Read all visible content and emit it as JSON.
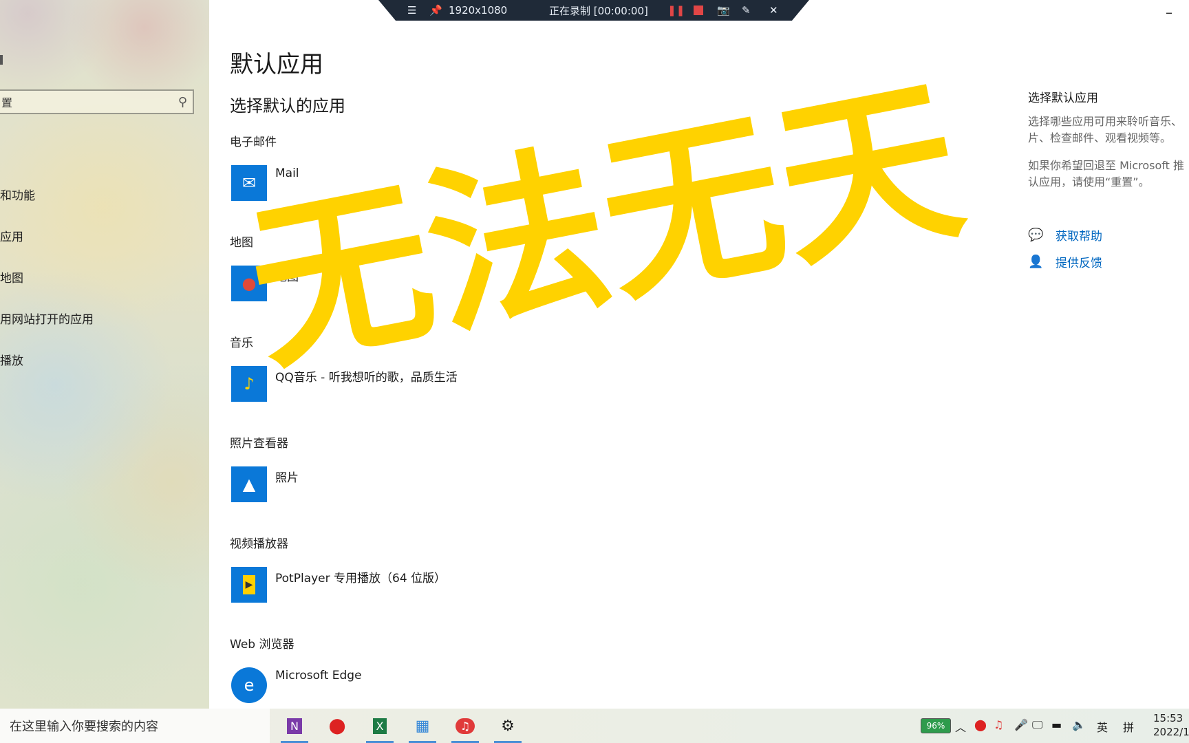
{
  "recording_bar": {
    "resolution": "1920x1080",
    "status": "正在录制 [00:00:00]"
  },
  "sidebar": {
    "search_value": "置",
    "items": [
      {
        "label": "和功能"
      },
      {
        "label": "应用"
      },
      {
        "label": "地图"
      },
      {
        "label": "用网站打开的应用"
      },
      {
        "label": "播放"
      }
    ]
  },
  "main": {
    "page_title": "默认应用",
    "section_title": "选择默认的应用",
    "categories": [
      {
        "label": "电子邮件",
        "app": "Mail"
      },
      {
        "label": "地图",
        "app": "地图"
      },
      {
        "label": "音乐",
        "app": "QQ音乐 - 听我想听的歌，品质生活"
      },
      {
        "label": "照片查看器",
        "app": "照片"
      },
      {
        "label": "视频播放器",
        "app": "PotPlayer 专用播放（64 位版）"
      },
      {
        "label": "Web 浏览器",
        "app": "Microsoft Edge"
      }
    ]
  },
  "info_panel": {
    "title": "选择默认应用",
    "para1_line1": "选择哪些应用可用来聆听音乐、",
    "para1_line2": "片、检查邮件、观看视频等。",
    "para2_line1": "如果你希望回退至 Microsoft 推",
    "para2_line2": "认应用，请使用“重置”。",
    "help_link": "获取帮助",
    "feedback_link": "提供反馈"
  },
  "overlay_text": "无法无天",
  "taskbar": {
    "search_placeholder": "在这里输入你要搜索的内容",
    "battery": "96%",
    "ime": "英",
    "ime2": "拼",
    "time": "15:53",
    "date": "2022/1"
  },
  "colors": {
    "accent": "#0067c0",
    "overlay": "#ffd200",
    "app_icon_bg": "#0078d4"
  }
}
